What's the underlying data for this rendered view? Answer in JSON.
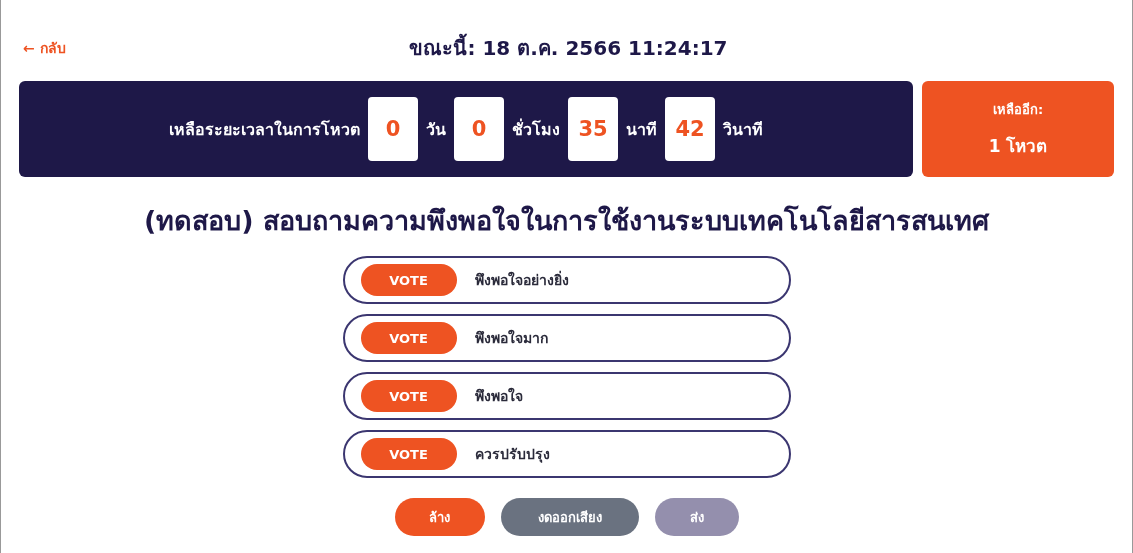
{
  "back_link": {
    "icon": "←",
    "label": "กลับ"
  },
  "now": "ขณะนี้: 18 ต.ค. 2566 11:24:17",
  "countdown": {
    "label": "เหลือระยะเวลาในการโหวต",
    "units": [
      {
        "value": "0",
        "unit": "วัน"
      },
      {
        "value": "0",
        "unit": "ชั่วโมง"
      },
      {
        "value": "35",
        "unit": "นาที"
      },
      {
        "value": "42",
        "unit": "วินาที"
      }
    ]
  },
  "remaining": {
    "label": "เหลืออีก:",
    "value": "1 โหวต"
  },
  "question": "(ทดสอบ) สอบถามความพึงพอใจในการใช้งานระบบเทคโนโลยีสารสนเทศ",
  "options": [
    {
      "button": "VOTE",
      "label": "พึงพอใจอย่างยิ่ง"
    },
    {
      "button": "VOTE",
      "label": "พึงพอใจมาก"
    },
    {
      "button": "VOTE",
      "label": "พึงพอใจ"
    },
    {
      "button": "VOTE",
      "label": "ควรปรับปรุง"
    }
  ],
  "actions": [
    {
      "kind": "clear",
      "label": "ล้าง",
      "disabled": false
    },
    {
      "kind": "abstain",
      "label": "งดออกเสียง",
      "disabled": false
    },
    {
      "kind": "submit",
      "label": "ส่ง",
      "disabled": true
    }
  ]
}
